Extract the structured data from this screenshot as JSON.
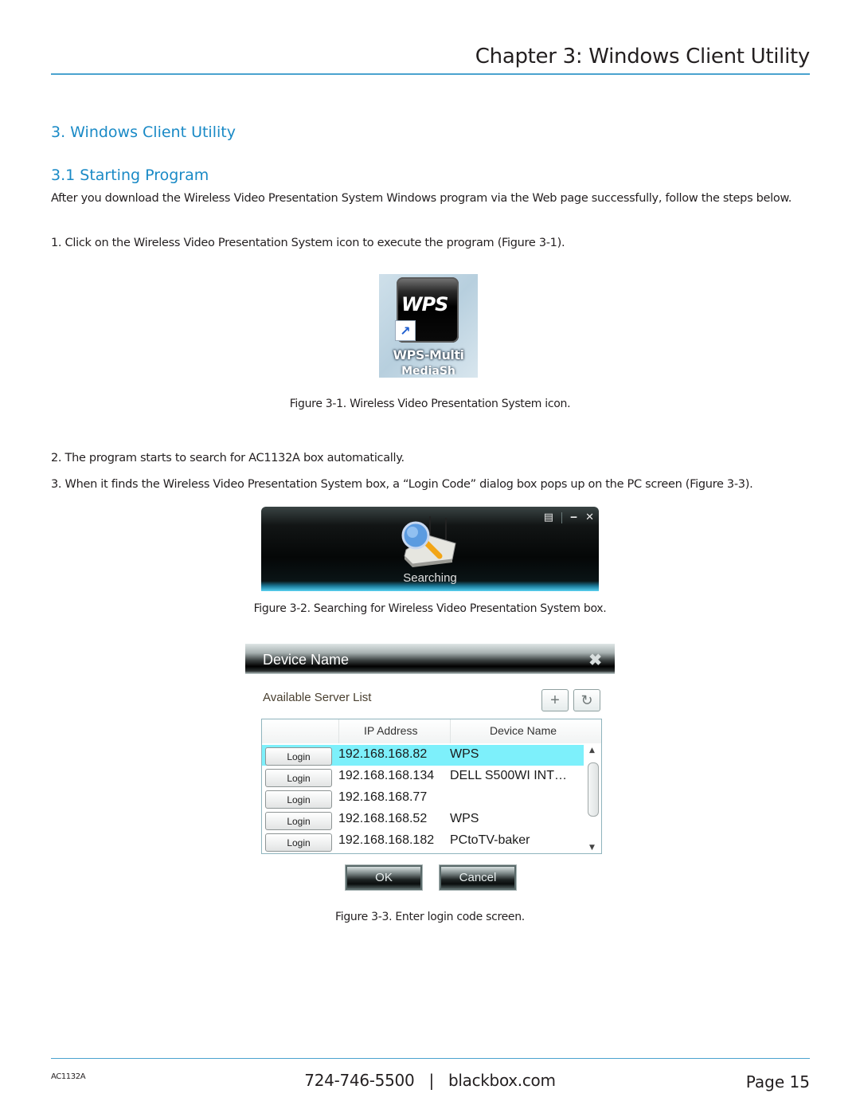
{
  "header": {
    "chapter_title": "Chapter 3: Windows Client Utility"
  },
  "section": {
    "title": "3. Windows Client Utility",
    "subsection_title": "3.1 Starting Program",
    "intro": "After you download the Wireless Video Presentation System Windows program via the Web page successfully, follow the steps below.",
    "steps": [
      "1. Click on the Wireless Video Presentation System icon to execute the program (Figure 3-1).",
      "2. The program starts to search for AC1132A box automatically.",
      "3. When it finds the Wireless Video Presentation System box, a “Login Code” dialog box pops up on the PC screen (Figure 3-3)."
    ]
  },
  "figures": {
    "fig1": {
      "caption": "Figure 3-1. Wireless Video Presentation System icon.",
      "icon_text": "WPS",
      "icon_label": "WPS-Multi",
      "icon_label_line2": "MediaSh",
      "shortcut_glyph": "↗"
    },
    "fig2": {
      "caption": "Figure 3-2. Searching for Wireless Video Presentation System box.",
      "status_label": "Searching",
      "controls": {
        "menu_glyph": "▤",
        "minimize_glyph": "‒",
        "close_glyph": "✕"
      }
    },
    "fig3": {
      "caption": "Figure 3-3. Enter login code screen.",
      "dialog_title": "Device Name",
      "close_glyph": "✖",
      "list_label": "Available Server List",
      "add_glyph": "+",
      "refresh_glyph": "↻",
      "columns": [
        "",
        "IP Address",
        "Device Name"
      ],
      "rows": [
        {
          "button": "Login",
          "ip": "192.168.168.82",
          "device": "WPS",
          "selected": true
        },
        {
          "button": "Login",
          "ip": "192.168.168.134",
          "device": "DELL S500WI INT…",
          "selected": false
        },
        {
          "button": "Login",
          "ip": "192.168.168.77",
          "device": "",
          "selected": false
        },
        {
          "button": "Login",
          "ip": "192.168.168.52",
          "device": "WPS",
          "selected": false
        },
        {
          "button": "Login",
          "ip": "192.168.168.182",
          "device": "PCtoTV-baker",
          "selected": false
        }
      ],
      "scroll_up_glyph": "▲",
      "scroll_down_glyph": "▼",
      "ok_label": "OK",
      "cancel_label": "Cancel",
      "selected_row_color": "#7df0fb"
    }
  },
  "footer": {
    "model": "AC1132A",
    "phone": "724-746-5500",
    "separator": "|",
    "website": "blackbox.com",
    "page": "Page 15"
  },
  "colors": {
    "heading_blue": "#1a8ac6",
    "rule_blue": "#4aa3cf",
    "body_text": "#231f20"
  }
}
